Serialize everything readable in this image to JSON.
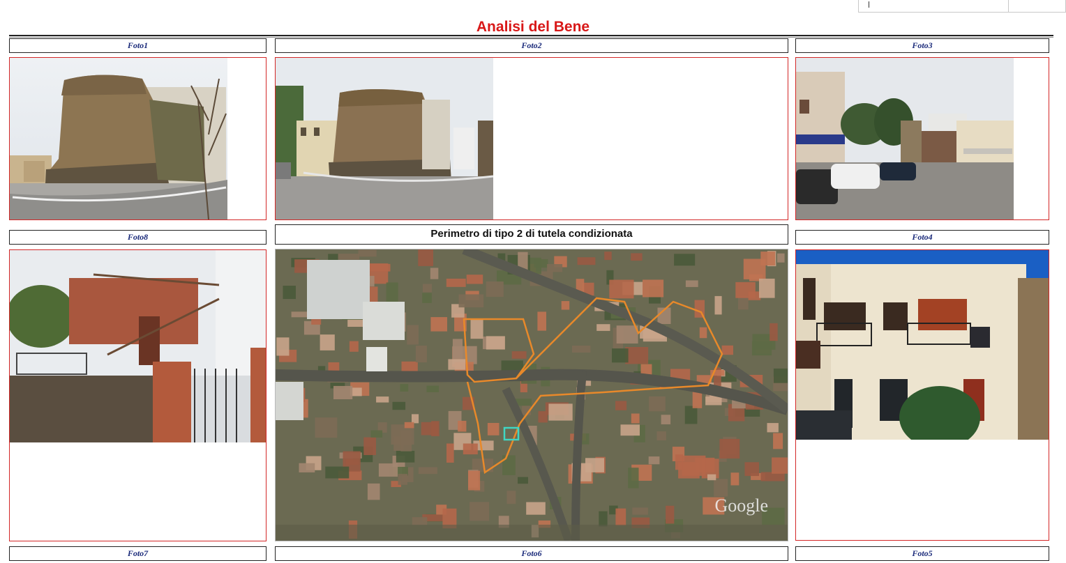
{
  "title": "Analisi del Bene",
  "labels": {
    "foto1": "Foto1",
    "foto2": "Foto2",
    "foto3": "Foto3",
    "foto8": "Foto8",
    "perimetro": "Perimetro di tipo 2 di tutela condizionata",
    "foto4": "Foto4",
    "foto7": "Foto7",
    "foto6": "Foto6",
    "foto5": "Foto5"
  },
  "map": {
    "watermark": "Google"
  },
  "colors": {
    "title": "#d81818",
    "frame_border": "#d32626",
    "label_text": "#1a2a7a",
    "perimeter_line": "#e8892a"
  }
}
